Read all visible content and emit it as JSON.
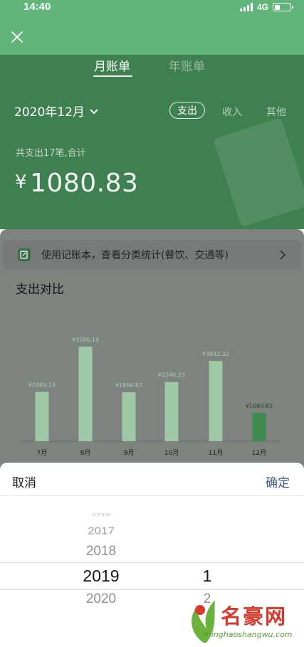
{
  "status_bar": {
    "time": "14:40",
    "network": "4G",
    "battery_level": 0.35
  },
  "tabs": [
    {
      "label": "月账单",
      "active": true
    },
    {
      "label": "年账单",
      "active": false
    }
  ],
  "summary": {
    "month": "2020年12月",
    "filters": [
      "支出",
      "收入",
      "其他"
    ],
    "active_filter": "支出",
    "count_text": "共支出17笔,合计",
    "currency": "¥",
    "total": "1080.83"
  },
  "banner": {
    "text": "使用记账本，查看分类统计(餐饮、交通等)"
  },
  "section_title": "支出对比",
  "chart_data": {
    "type": "bar",
    "categories": [
      "7月",
      "8月",
      "9月",
      "10月",
      "11月",
      "12月"
    ],
    "values": [
      1869.24,
      3586.14,
      1856.87,
      2246.23,
      3042.32,
      1080.83
    ],
    "labels": [
      "¥1869.24",
      "¥3586.14",
      "¥1856.87",
      "¥2246.23",
      "¥3042.32",
      "¥1080.83"
    ],
    "highlight_index": 5,
    "colors": {
      "bar": "#9ec8a6",
      "highlight": "#3f8a4f",
      "label": "#a9cdb0",
      "highlight_label": "#1f4a2a"
    }
  },
  "picker": {
    "cancel_label": "取消",
    "confirm_label": "确定",
    "years": [
      "2016",
      "2017",
      "2018",
      "2019",
      "2020"
    ],
    "selected_year": "2019",
    "months": [
      "1",
      "2"
    ],
    "selected_month": "1"
  },
  "watermark": {
    "text": "名豪网",
    "url": "minghaoshangwu.com"
  }
}
